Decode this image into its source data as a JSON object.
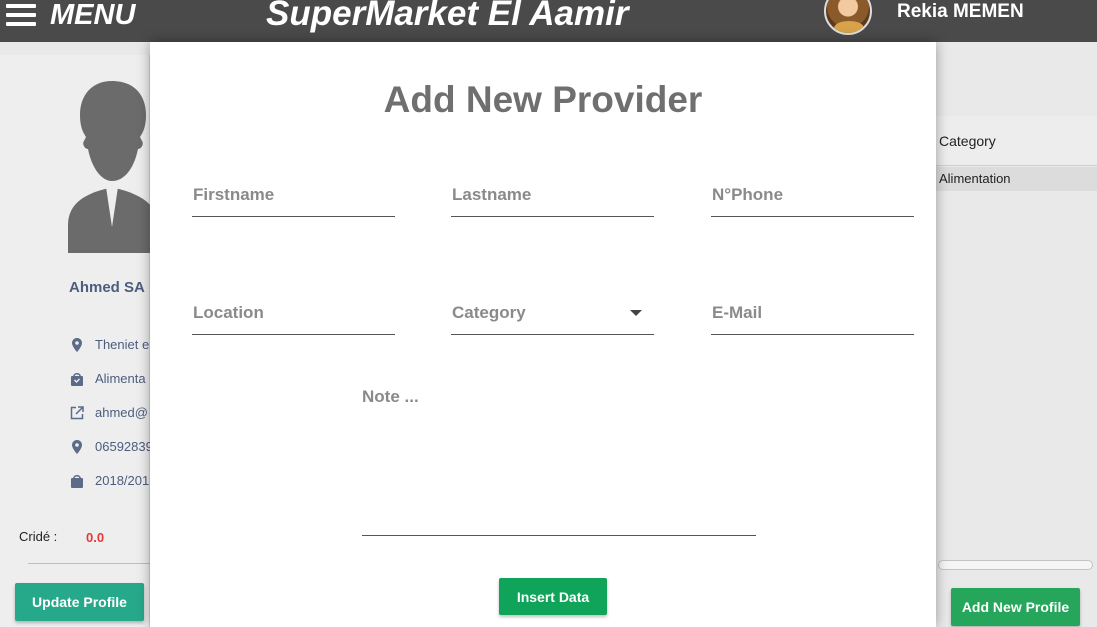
{
  "header": {
    "menu_label": "MENU",
    "app_title": "SuperMarket El Aamir",
    "user_name": "Rekia MEMEN"
  },
  "profile": {
    "name": "Ahmed SA",
    "info": [
      {
        "icon": "location-pin-icon",
        "text": "Theniet e"
      },
      {
        "icon": "shopping-bag-icon",
        "text": "Alimenta"
      },
      {
        "icon": "external-link-icon",
        "text": "ahmed@"
      },
      {
        "icon": "location-pin-icon",
        "text": "06592839"
      },
      {
        "icon": "shopping-bag-icon",
        "text": "2018/201"
      }
    ],
    "credit_label": "Cridé :",
    "credit_value": "0.0",
    "update_button": "Update Profile"
  },
  "table": {
    "column_header": "Category",
    "rows": [
      "Alimentation"
    ],
    "add_button": "Add New Profile"
  },
  "modal": {
    "title": "Add New Provider",
    "firstname_placeholder": "Firstname",
    "lastname_placeholder": "Lastname",
    "phone_placeholder": "N°Phone",
    "location_placeholder": "Location",
    "category_placeholder": "Category",
    "email_placeholder": "E-Mail",
    "note_placeholder": "Note ...",
    "insert_button": "Insert Data"
  },
  "colors": {
    "header_bg": "#4a4a4a",
    "update_button": "#26a98a",
    "insert_button": "#10a35a",
    "add_profile_button": "#26a65b",
    "credit_value": "#e53935",
    "info_text": "#4d5d7e"
  }
}
